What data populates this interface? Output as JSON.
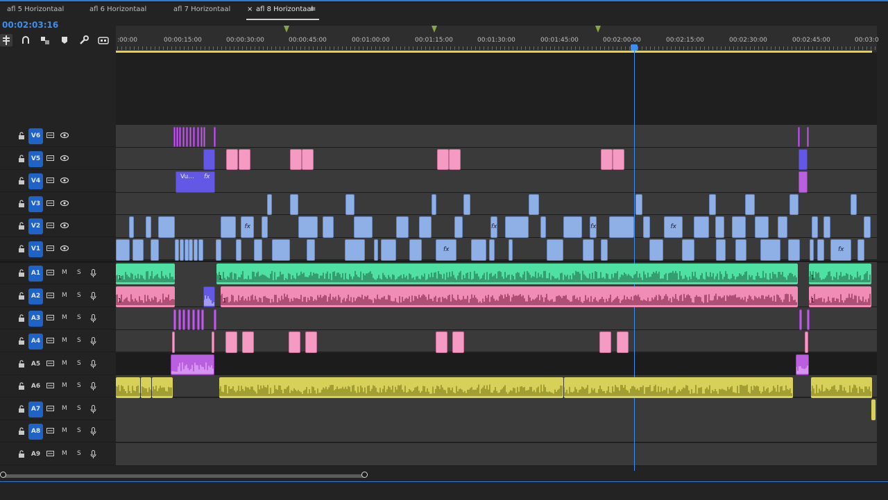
{
  "tabs": [
    {
      "label": "afl 5 Horizontaal",
      "active": false
    },
    {
      "label": "afl 6 Horizontaal",
      "active": false
    },
    {
      "label": "afl 7 Horizontaal",
      "active": false
    },
    {
      "label": "afl 8 Horizontaal",
      "active": true
    }
  ],
  "tab_close_glyph": "×",
  "tab_menu_glyph": "≡",
  "timecode": "00:02:03:16",
  "toolbar": {
    "tools": [
      "insert-sequence-icon",
      "snap-magnet-icon",
      "linked-selection-icon",
      "marker-icon",
      "wrench-icon",
      "captions-icon"
    ]
  },
  "ruler": {
    "labels": [
      ":00:00",
      "00:00:15:00",
      "00:00:30:00",
      "00:00:45:00",
      "00:01:00:00",
      "00:01:15:00",
      "00:01:30:00",
      "00:01:45:00",
      "00:02:00:00",
      "00:02:15:00",
      "00:02:30:00",
      "00:02:45:00",
      "00:03:0"
    ]
  },
  "tracks": {
    "video": [
      {
        "label": "V6",
        "targeted": true
      },
      {
        "label": "V5",
        "targeted": true
      },
      {
        "label": "V4",
        "targeted": true
      },
      {
        "label": "V3",
        "targeted": true
      },
      {
        "label": "V2",
        "targeted": true
      },
      {
        "label": "V1",
        "targeted": true
      }
    ],
    "audio": [
      {
        "label": "A1",
        "targeted": true
      },
      {
        "label": "A2",
        "targeted": true
      },
      {
        "label": "A3",
        "targeted": true
      },
      {
        "label": "A4",
        "targeted": true
      },
      {
        "label": "A5",
        "targeted": false
      },
      {
        "label": "A6",
        "targeted": false
      },
      {
        "label": "A7",
        "targeted": true
      },
      {
        "label": "A8",
        "targeted": true
      },
      {
        "label": "A9",
        "targeted": false
      }
    ],
    "mute_label": "M",
    "solo_label": "S"
  },
  "clips": {
    "v4_title": "Vu...",
    "fx_label": "fx",
    "audio_channel": "1"
  },
  "colors": {
    "accent": "#1f63c7",
    "playhead": "#3c8ff0",
    "video_clip": "#8fb0e6",
    "pink_clip": "#f59bc3",
    "purple_clip": "#b95fe0",
    "violet_clip": "#6357e6",
    "audio_green": "#4fe0a4",
    "audio_pink": "#f08cb6",
    "audio_yellow": "#d7d159",
    "work_area": "#e8d23a"
  }
}
